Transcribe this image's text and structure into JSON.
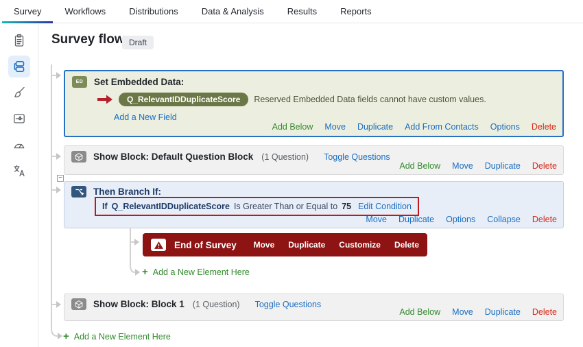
{
  "nav": {
    "tabs": [
      {
        "label": "Survey",
        "active": true
      },
      {
        "label": "Workflows",
        "active": false
      },
      {
        "label": "Distributions",
        "active": false
      },
      {
        "label": "Data & Analysis",
        "active": false
      },
      {
        "label": "Results",
        "active": false
      },
      {
        "label": "Reports",
        "active": false
      }
    ]
  },
  "sidebar": {
    "icons": [
      "survey-builder",
      "survey-flow",
      "look-and-feel",
      "survey-options",
      "expert-review",
      "translations"
    ],
    "active": "survey-flow"
  },
  "header": {
    "title": "Survey flow",
    "status": "Draft"
  },
  "flow": {
    "embedded_data": {
      "icon_label": "ED",
      "title": "Set Embedded Data:",
      "field": "Q_RelevantIDDuplicateScore",
      "note": "Reserved Embedded Data fields cannot have custom values.",
      "add_field": "Add a New Field",
      "actions": [
        {
          "label": "Add Below"
        },
        {
          "label": "Move"
        },
        {
          "label": "Duplicate"
        },
        {
          "label": "Add From Contacts"
        },
        {
          "label": "Options"
        },
        {
          "label": "Delete"
        }
      ]
    },
    "default_block": {
      "title": "Show Block: Default Question Block",
      "count": "(1 Question)",
      "toggle": "Toggle Questions",
      "actions": [
        {
          "label": "Add Below"
        },
        {
          "label": "Move"
        },
        {
          "label": "Duplicate"
        },
        {
          "label": "Delete"
        }
      ]
    },
    "branch": {
      "collapse_glyph": "−",
      "title": "Then Branch If:",
      "condition": {
        "if_word": "If",
        "field": "Q_RelevantIDDuplicateScore",
        "operator": "Is Greater Than or Equal to",
        "value": "75",
        "edit": "Edit Condition"
      },
      "actions": [
        {
          "label": "Move"
        },
        {
          "label": "Duplicate"
        },
        {
          "label": "Options"
        },
        {
          "label": "Collapse"
        },
        {
          "label": "Delete"
        }
      ]
    },
    "end_of_survey": {
      "title": "End of Survey",
      "actions": [
        {
          "label": "Move"
        },
        {
          "label": "Duplicate"
        },
        {
          "label": "Customize"
        },
        {
          "label": "Delete"
        }
      ]
    },
    "block1": {
      "title": "Show Block: Block 1",
      "count": "(1 Question)",
      "toggle": "Toggle Questions",
      "actions": [
        {
          "label": "Add Below"
        },
        {
          "label": "Move"
        },
        {
          "label": "Duplicate"
        },
        {
          "label": "Delete"
        }
      ]
    },
    "add_element_branch": "Add a New Element Here",
    "add_element_main": "Add a New Element Here"
  },
  "colors": {
    "link_blue": "#1a6dc0",
    "action_green": "#338a2e",
    "delete_red": "#d62718",
    "end_of_survey_bg": "#8e1313",
    "embedded_bg": "#ecefdf",
    "embedded_border": "#2470c2",
    "pill_bg": "#6b7747",
    "branch_bg": "#e8eef8",
    "branch_navy": "#1c3a66",
    "annotation_red": "#c01820",
    "tab_underline_gradient": [
      "#14b8b4",
      "#2a35a6"
    ]
  }
}
